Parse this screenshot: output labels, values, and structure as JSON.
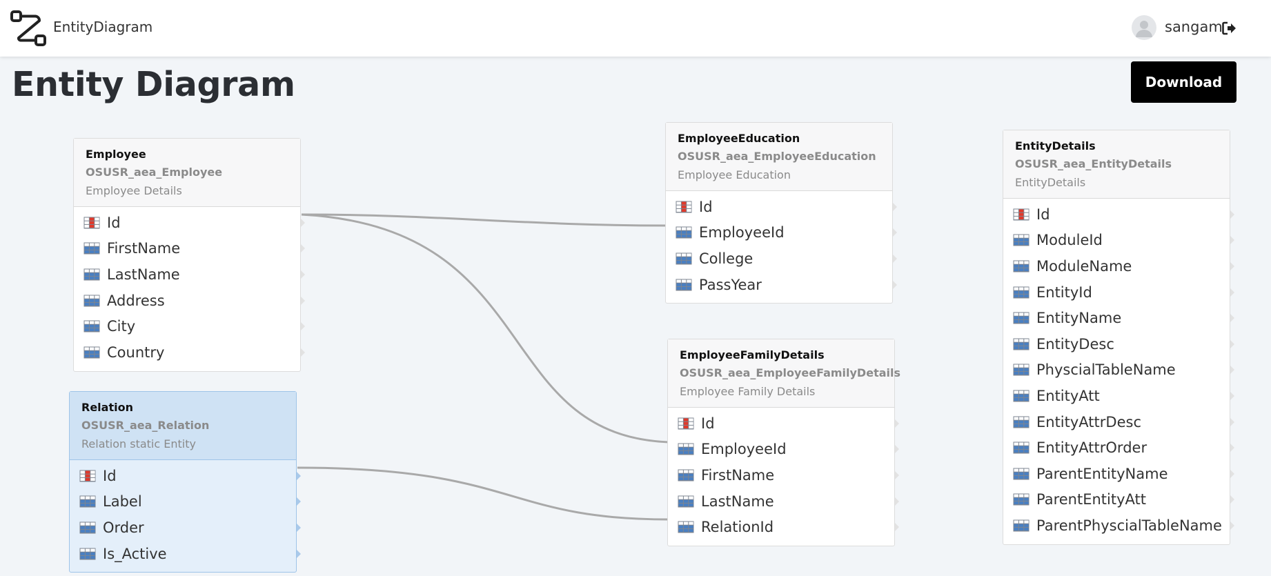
{
  "app": {
    "title": "EntityDiagram",
    "logo_icon": "flow-diagram-icon"
  },
  "user": {
    "name": "sangam",
    "avatar_icon": "user-avatar-icon",
    "logout_icon": "logout-icon"
  },
  "page": {
    "title": "Entity Diagram",
    "download_label": "Download"
  },
  "colors": {
    "primary_key_icon": "#e0392b",
    "attribute_icon": "#4a7fc1",
    "connector": "#a9a9a9",
    "selected_entity_bg": "#e4effa",
    "button_bg": "#000000"
  },
  "entities": [
    {
      "id": "employee",
      "name": "Employee",
      "table": "OSUSR_aea_Employee",
      "description": "Employee Details",
      "selected": false,
      "attributes": [
        {
          "label": "Id",
          "key": true
        },
        {
          "label": "FirstName",
          "key": false
        },
        {
          "label": "LastName",
          "key": false
        },
        {
          "label": "Address",
          "key": false
        },
        {
          "label": "City",
          "key": false
        },
        {
          "label": "Country",
          "key": false
        }
      ]
    },
    {
      "id": "relation",
      "name": "Relation",
      "table": "OSUSR_aea_Relation",
      "description": "Relation static Entity",
      "selected": true,
      "attributes": [
        {
          "label": "Id",
          "key": true
        },
        {
          "label": "Label",
          "key": false
        },
        {
          "label": "Order",
          "key": false
        },
        {
          "label": "Is_Active",
          "key": false
        }
      ]
    },
    {
      "id": "employee-education",
      "name": "EmployeeEducation",
      "table": "OSUSR_aea_EmployeeEducation",
      "description": "Employee Education",
      "selected": false,
      "attributes": [
        {
          "label": "Id",
          "key": true
        },
        {
          "label": "EmployeeId",
          "key": false
        },
        {
          "label": "College",
          "key": false
        },
        {
          "label": "PassYear",
          "key": false
        }
      ]
    },
    {
      "id": "employee-family-details",
      "name": "EmployeeFamilyDetails",
      "table": "OSUSR_aea_EmployeeFamilyDetails",
      "description": "Employee Family Details",
      "selected": false,
      "attributes": [
        {
          "label": "Id",
          "key": true
        },
        {
          "label": "EmployeeId",
          "key": false
        },
        {
          "label": "FirstName",
          "key": false
        },
        {
          "label": "LastName",
          "key": false
        },
        {
          "label": "RelationId",
          "key": false
        }
      ]
    },
    {
      "id": "entity-details",
      "name": "EntityDetails",
      "table": "OSUSR_aea_EntityDetails",
      "description": "EntityDetails",
      "selected": false,
      "attributes": [
        {
          "label": "Id",
          "key": true
        },
        {
          "label": "ModuleId",
          "key": false
        },
        {
          "label": "ModuleName",
          "key": false
        },
        {
          "label": "EntityId",
          "key": false
        },
        {
          "label": "EntityName",
          "key": false
        },
        {
          "label": "EntityDesc",
          "key": false
        },
        {
          "label": "PhyscialTableName",
          "key": false
        },
        {
          "label": "EntityAtt",
          "key": false
        },
        {
          "label": "EntityAttrDesc",
          "key": false
        },
        {
          "label": "EntityAttrOrder",
          "key": false
        },
        {
          "label": "ParentEntityName",
          "key": false
        },
        {
          "label": "ParentEntityAtt",
          "key": false
        },
        {
          "label": "ParentPhyscialTableName",
          "key": false
        }
      ]
    }
  ],
  "links": [
    {
      "from": "employee.Id",
      "to": "employee-education.EmployeeId"
    },
    {
      "from": "employee.Id",
      "to": "employee-family-details.EmployeeId"
    },
    {
      "from": "relation.Id",
      "to": "employee-family-details.RelationId"
    }
  ]
}
